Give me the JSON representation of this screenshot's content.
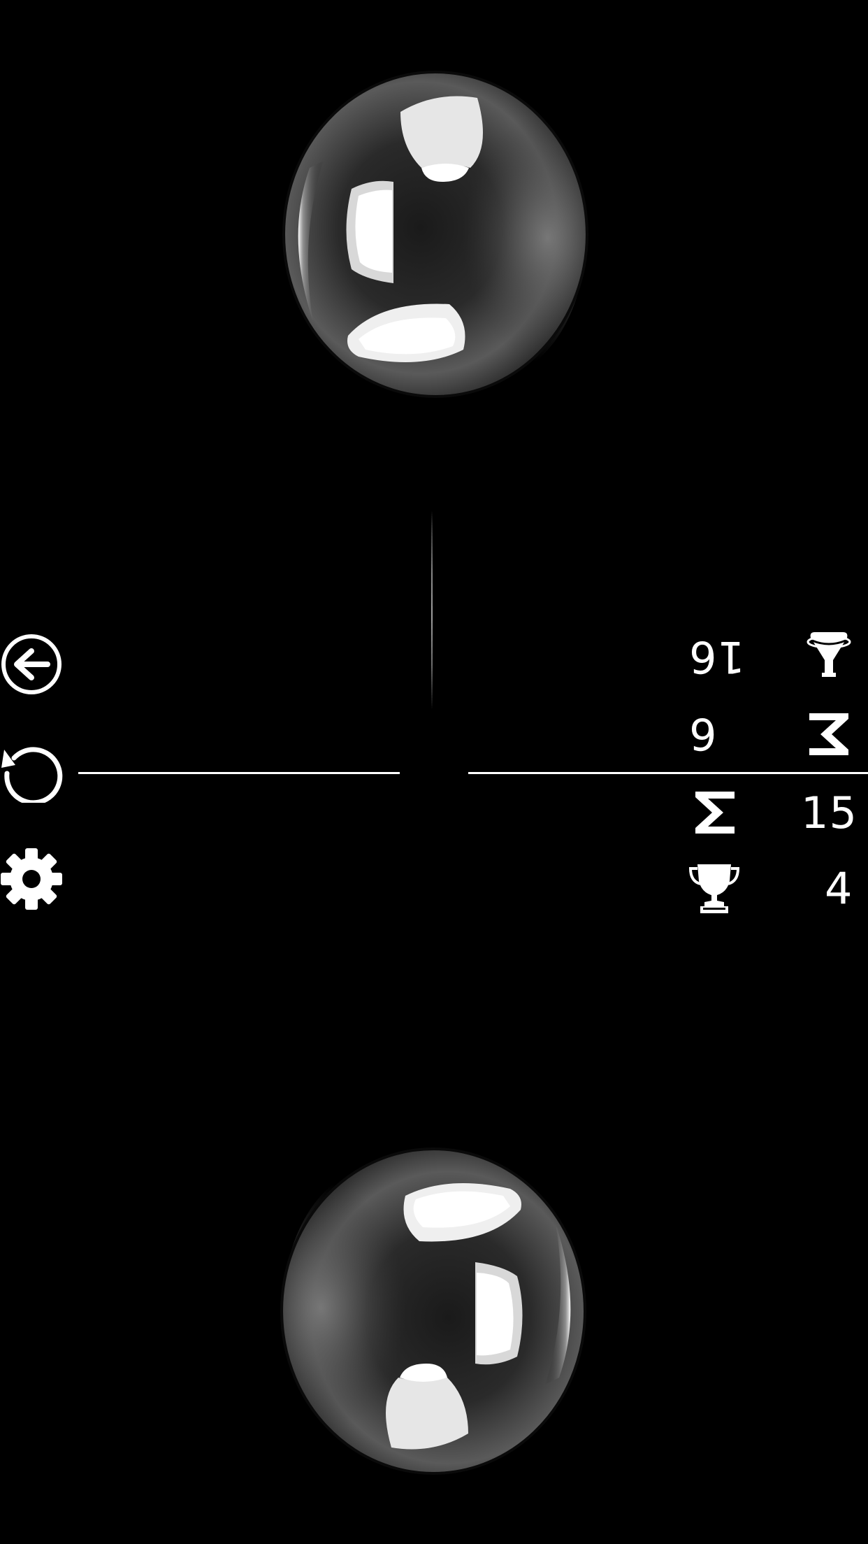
{
  "controls": {
    "back_icon": "arrow-left-circle-icon",
    "restart_icon": "restart-icon",
    "settings_icon": "gear-icon"
  },
  "stats": {
    "opponent": {
      "moves_icon": "flask-icon",
      "moves": "16",
      "total_icon": "sigma-icon",
      "total": "6"
    },
    "player": {
      "total_icon": "sigma-icon",
      "total": "15",
      "wins_icon": "trophy-icon",
      "wins": "4"
    }
  },
  "board": {
    "top_ball": "chrome-sphere",
    "bottom_ball": "chrome-sphere"
  },
  "colors": {
    "background": "#000000",
    "foreground": "#ffffff"
  }
}
